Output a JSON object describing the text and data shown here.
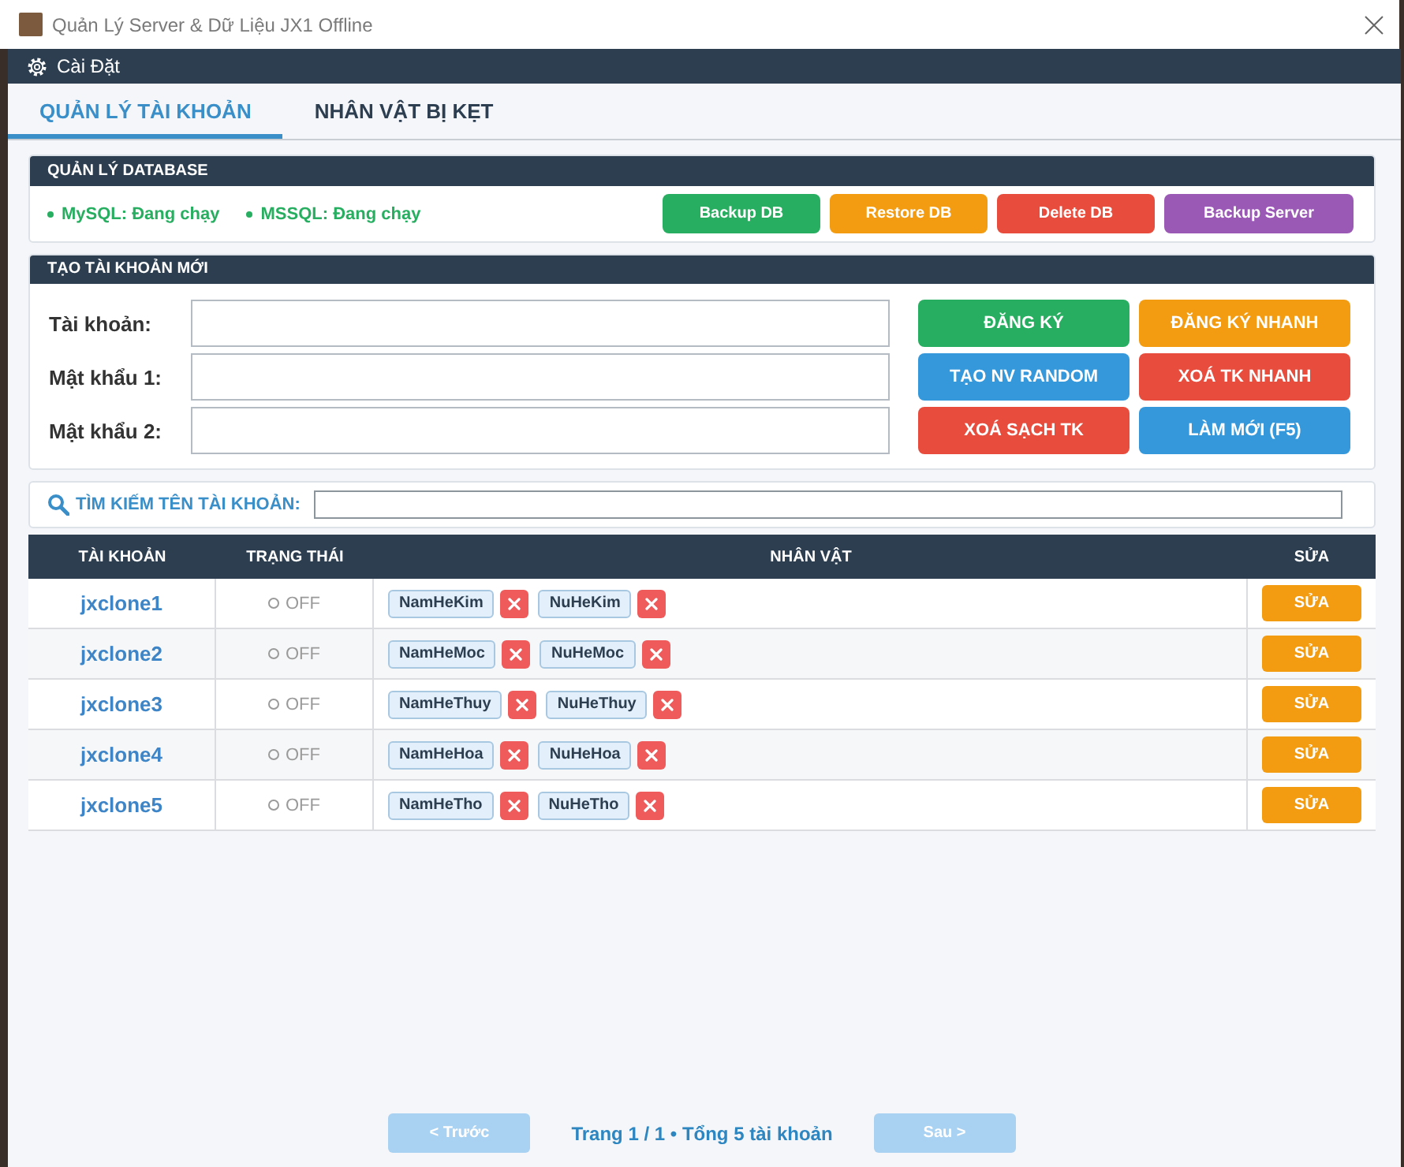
{
  "window": {
    "title": "Quản Lý Server & Dữ Liệu JX1 Offline"
  },
  "menu": {
    "items": [
      {
        "label": "Cài Đặt"
      }
    ]
  },
  "tabs": [
    {
      "label": "QUẢN LÝ TÀI KHOẢN",
      "selected": true
    },
    {
      "label": "NHÂN VẬT BỊ KẸT",
      "selected": false
    }
  ],
  "database_panel": {
    "title": "QUẢN LÝ DATABASE",
    "services": [
      {
        "label": "MySQL: Đang chạy",
        "running": true
      },
      {
        "label": "MSSQL: Đang chạy",
        "running": true
      }
    ],
    "buttons": [
      {
        "label": "Backup DB",
        "color": "#27ae60"
      },
      {
        "label": "Restore DB",
        "color": "#f39c12"
      },
      {
        "label": "Delete DB",
        "color": "#e74c3c"
      },
      {
        "label": "Backup Server",
        "color": "#9b59b6"
      }
    ]
  },
  "create_panel": {
    "title": "TẠO TÀI KHOẢN MỚI",
    "fields": [
      {
        "label": "Tài khoản:"
      },
      {
        "label": "Mật khẩu 1:"
      },
      {
        "label": "Mật khẩu 2:"
      }
    ],
    "buttons": [
      {
        "label": "ĐĂNG KÝ",
        "color": "#27ae60"
      },
      {
        "label": "ĐĂNG KÝ NHANH",
        "color": "#f39c12"
      },
      {
        "label": "TẠO NV RANDOM",
        "color": "#3498db"
      },
      {
        "label": "XOÁ TK NHANH",
        "color": "#e74c3c"
      },
      {
        "label": "XOÁ SẠCH TK",
        "color": "#e74c3c"
      },
      {
        "label": "LÀM MỚI (F5)",
        "color": "#3498db"
      }
    ]
  },
  "search": {
    "label": "TÌM KIẾM TÊN TÀI KHOẢN:"
  },
  "table": {
    "columns": [
      "TÀI KHOẢN",
      "TRẠNG THÁI",
      "NHÂN VẬT",
      "SỬA"
    ],
    "rows": [
      {
        "account": "jxclone1",
        "online": false,
        "status": "OFF",
        "characters": [
          "NamHeKim",
          "NuHeKim"
        ],
        "action": "SỬA"
      },
      {
        "account": "jxclone2",
        "online": false,
        "status": "OFF",
        "characters": [
          "NamHeMoc",
          "NuHeMoc"
        ],
        "action": "SỬA"
      },
      {
        "account": "jxclone3",
        "online": false,
        "status": "OFF",
        "characters": [
          "NamHeThuy",
          "NuHeThuy"
        ],
        "action": "SỬA"
      },
      {
        "account": "jxclone4",
        "online": false,
        "status": "OFF",
        "characters": [
          "NamHeHoa",
          "NuHeHoa"
        ],
        "action": "SỬA"
      },
      {
        "account": "jxclone5",
        "online": false,
        "status": "OFF",
        "characters": [
          "NamHeTho",
          "NuHeTho"
        ],
        "action": "SỬA"
      }
    ]
  },
  "pagination": {
    "prev": {
      "label": "< Trước",
      "disabled": true
    },
    "info": "Trang 1 / 1 • Tổng 5 tài khoản",
    "next": {
      "label": "Sau >",
      "disabled": true
    }
  }
}
